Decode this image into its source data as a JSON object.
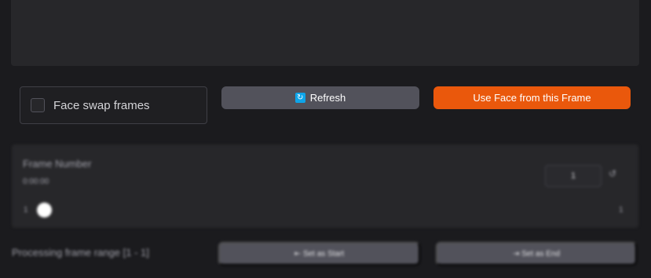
{
  "face_swap_checkbox": {
    "label": "Face swap frames",
    "checked": false
  },
  "buttons": {
    "refresh_label": "Refresh",
    "use_face_label": "Use Face from this Frame",
    "set_start_label": "⇤ Set as Start",
    "set_end_label": "⇥ Set as End"
  },
  "frame_slider": {
    "label": "Frame Number",
    "time": "0:00:00",
    "value": "1",
    "min": "1",
    "max": "1"
  },
  "range": {
    "label": "Processing frame range [1 - 1]"
  },
  "icons": {
    "refresh": "refresh-icon",
    "reset": "reset-icon"
  },
  "colors": {
    "accent": "#ea580c",
    "refresh_icon": "#0ea5e9"
  }
}
